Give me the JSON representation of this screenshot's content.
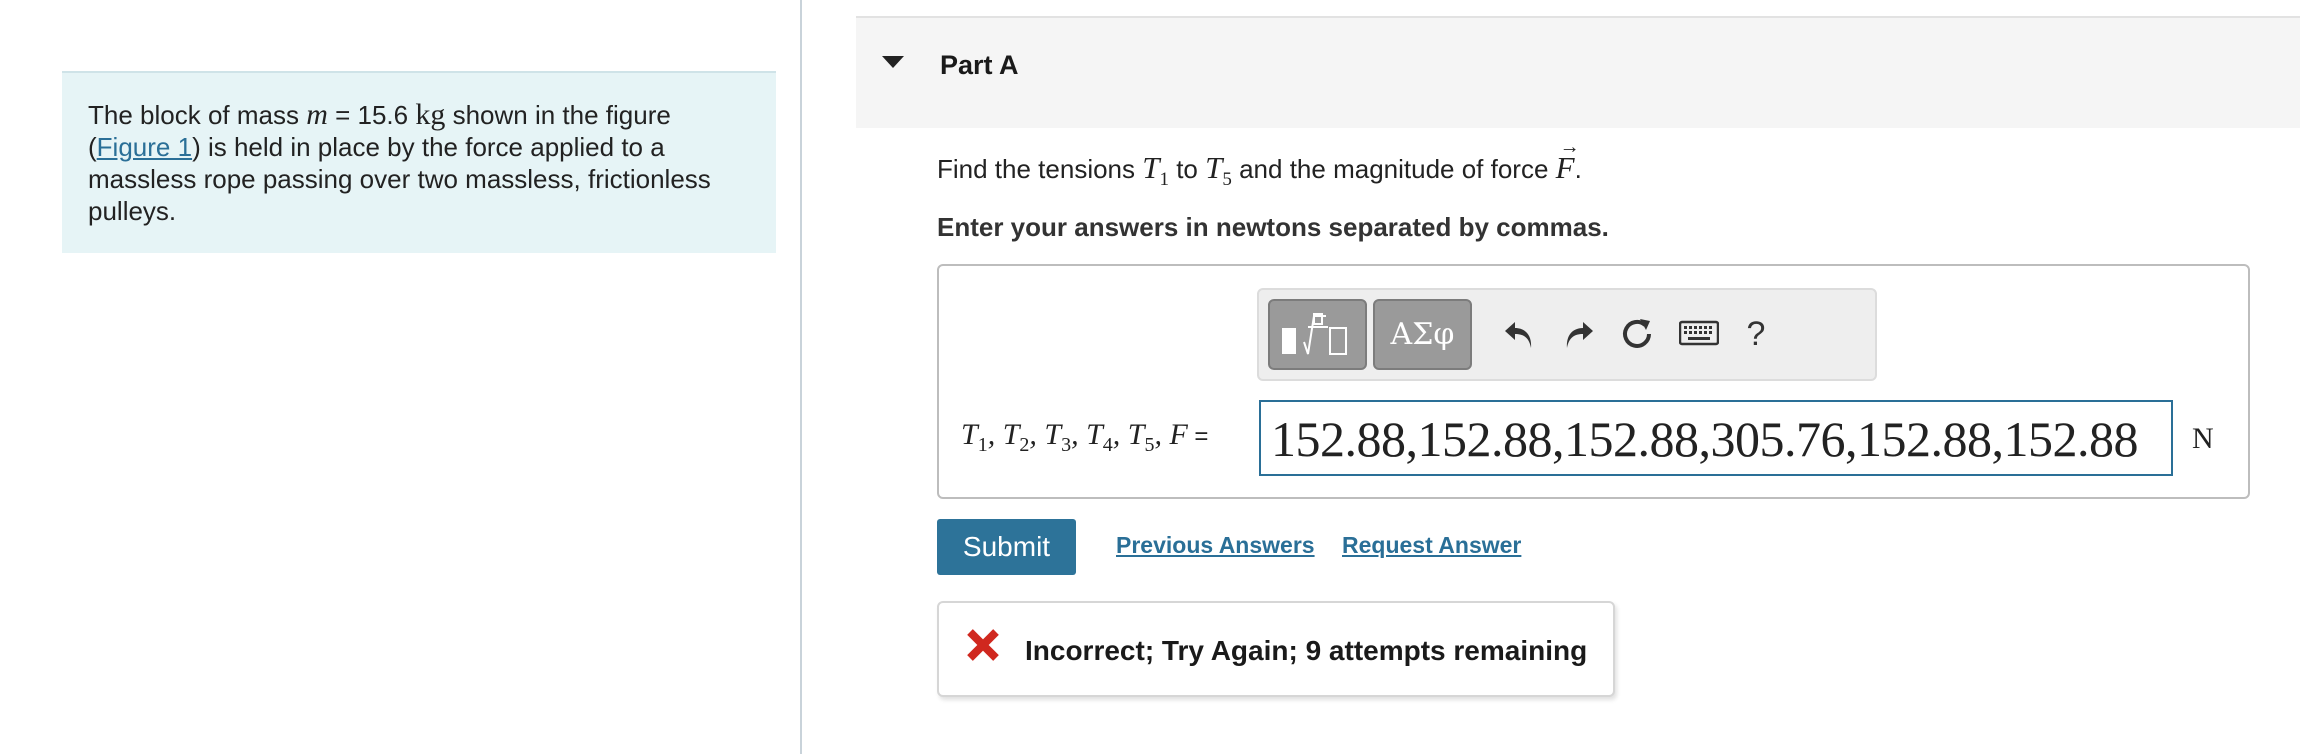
{
  "problem": {
    "text_1": "The block of mass ",
    "mass_var": "m",
    "mass_eq": " = 15.6 ",
    "mass_unit": "kg",
    "text_2": " shown in the figure",
    "paren_open": "(",
    "figure_link": "Figure 1",
    "text_3": ") is held in place by the force applied to a massless rope passing over two massless, frictionless pulleys."
  },
  "part": {
    "title": "Part A",
    "prompt_1": "Find the tensions ",
    "prompt_var1": "T",
    "prompt_sub1": "1",
    "prompt_2": " to ",
    "prompt_var2": "T",
    "prompt_sub2": "5",
    "prompt_3": " and the magnitude of force ",
    "prompt_var3": "F",
    "prompt_arrow": "→",
    "prompt_4": ".",
    "instruction": "Enter your answers in newtons separated by commas."
  },
  "toolbar": {
    "templates_icon": "fraction-radical-template-icon",
    "greek_label": "ΑΣφ",
    "undo_icon": "undo-icon",
    "redo_icon": "redo-icon",
    "reset_icon": "reset-icon",
    "keyboard_icon": "keyboard-icon",
    "help_label": "?"
  },
  "answer": {
    "label_vars": [
      "T",
      "T",
      "T",
      "T",
      "T",
      "F"
    ],
    "label_subs": [
      "1",
      "2",
      "3",
      "4",
      "5"
    ],
    "label_sep": ", ",
    "label_eq": " =",
    "value": "152.88,152.88,152.88,305.76,152.88,152.88",
    "unit": "N"
  },
  "actions": {
    "submit": "Submit",
    "previous_answers": "Previous Answers",
    "request_answer": "Request Answer"
  },
  "feedback": {
    "icon": "x-icon",
    "text": "Incorrect; Try Again; 9 attempts remaining",
    "color": "#d0281f"
  },
  "colors": {
    "accent": "#2d7399",
    "link": "#2a6f97",
    "problem_bg": "#e6f4f6"
  }
}
